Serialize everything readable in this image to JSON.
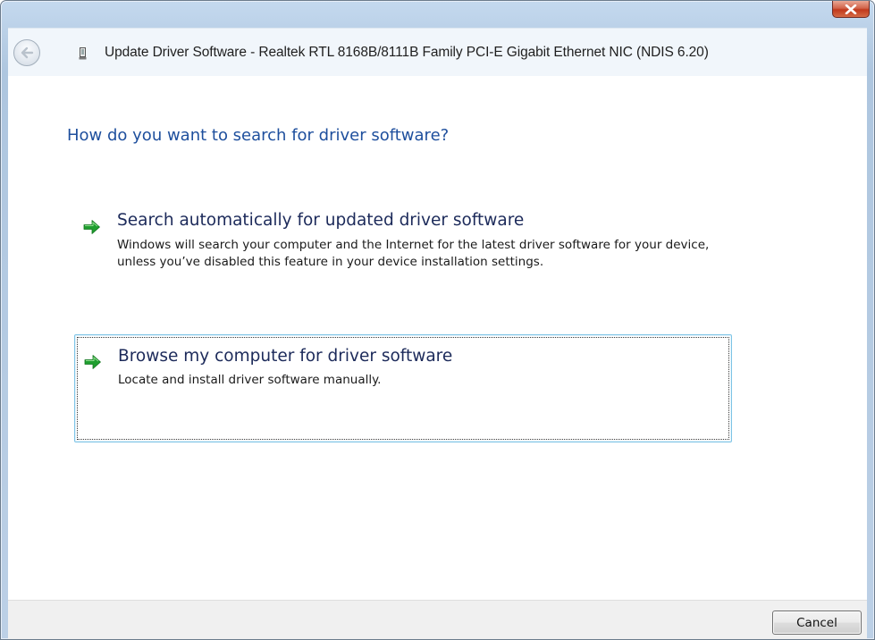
{
  "window": {
    "title": "Update Driver Software - Realtek RTL 8168B/8111B Family PCI-E Gigabit Ethernet NIC (NDIS 6.20)"
  },
  "icons": {
    "close": "close-icon",
    "back": "back-arrow-icon",
    "device": "network-adapter-icon",
    "option_arrow": "green-arrow-icon"
  },
  "content": {
    "heading": "How do you want to search for driver software?",
    "options": [
      {
        "title": "Search automatically for updated driver software",
        "description": "Windows will search your computer and the Internet for the latest driver software for your device, unless you’ve disabled this feature in your device installation settings."
      },
      {
        "title": "Browse my computer for driver software",
        "description": "Locate and install driver software manually."
      }
    ]
  },
  "footer": {
    "cancel_label": "Cancel"
  },
  "colors": {
    "heading": "#1e4f9d",
    "option_title": "#1c2a5a",
    "arrow_green": "#1f9e2f",
    "frame": "#b9cfe6",
    "focus_border": "#7ec4e6"
  }
}
